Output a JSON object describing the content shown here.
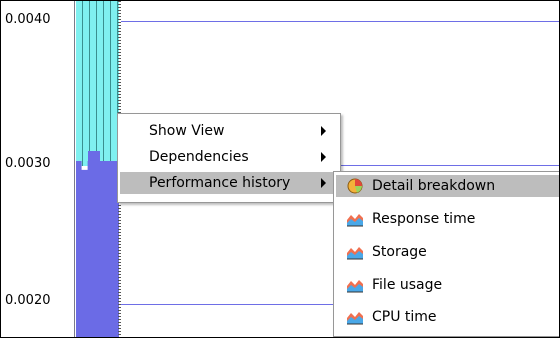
{
  "chart": {
    "y_ticks": [
      "0.0040",
      "0.0030",
      "0.0020"
    ],
    "colors": {
      "bar_top": "#7ff0f0",
      "bar_bottom": "#6b6be6",
      "gridline": "#6e6ee6"
    }
  },
  "context_menu": {
    "items": [
      {
        "label": "Show View",
        "has_submenu": true
      },
      {
        "label": "Dependencies",
        "has_submenu": true
      },
      {
        "label": "Performance history",
        "has_submenu": true,
        "selected": true
      }
    ]
  },
  "submenu": {
    "items": [
      {
        "label": "Detail breakdown",
        "icon": "pie-chart-icon",
        "selected": true
      },
      {
        "label": "Response time",
        "icon": "area-chart-icon"
      },
      {
        "label": "Storage",
        "icon": "area-chart-icon"
      },
      {
        "label": "File usage",
        "icon": "area-chart-icon"
      },
      {
        "label": "CPU time",
        "icon": "area-chart-icon"
      }
    ],
    "highlight_color": "#bdbdbd"
  }
}
